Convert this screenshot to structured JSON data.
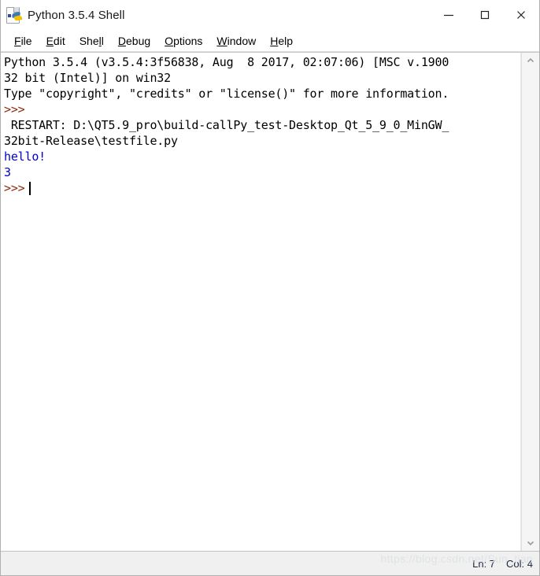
{
  "window": {
    "title": "Python 3.5.4 Shell",
    "icon": "python-idle-icon",
    "controls": {
      "minimize": "minimize-button",
      "maximize": "maximize-button",
      "close": "close-button"
    }
  },
  "menubar": {
    "items": [
      {
        "label": "File",
        "accel": "F"
      },
      {
        "label": "Edit",
        "accel": "E"
      },
      {
        "label": "Shell",
        "accel": "l"
      },
      {
        "label": "Debug",
        "accel": "D"
      },
      {
        "label": "Options",
        "accel": "O"
      },
      {
        "label": "Window",
        "accel": "W"
      },
      {
        "label": "Help",
        "accel": "H"
      }
    ]
  },
  "shell": {
    "lines": [
      {
        "text": "Python 3.5.4 (v3.5.4:3f56838, Aug  8 2017, 02:07:06) [MSC v.1900",
        "style": "normal"
      },
      {
        "text": "32 bit (Intel)] on win32",
        "style": "normal"
      },
      {
        "text": "Type \"copyright\", \"credits\" or \"license()\" for more information.",
        "style": "normal"
      },
      {
        "text": ">>>",
        "style": "prompt"
      },
      {
        "text": " RESTART: D:\\QT5.9_pro\\build-callPy_test-Desktop_Qt_5_9_0_MinGW_",
        "style": "normal"
      },
      {
        "text": "32bit-Release\\testfile.py",
        "style": "normal"
      },
      {
        "text": "hello!",
        "style": "stdout"
      },
      {
        "text": "3",
        "style": "stdout"
      }
    ],
    "final_prompt": ">>>",
    "colors": {
      "normal": "#000000",
      "stdout": "#0000cc",
      "prompt": "#8b2c0f"
    }
  },
  "scrollbar": {
    "up_arrow": "scroll-up-arrow",
    "down_arrow": "scroll-down-arrow"
  },
  "statusbar": {
    "line_label": "Ln: 7",
    "col_label": "Col: 4",
    "watermark": "https://blog.csdn.net/Sun_tian"
  }
}
